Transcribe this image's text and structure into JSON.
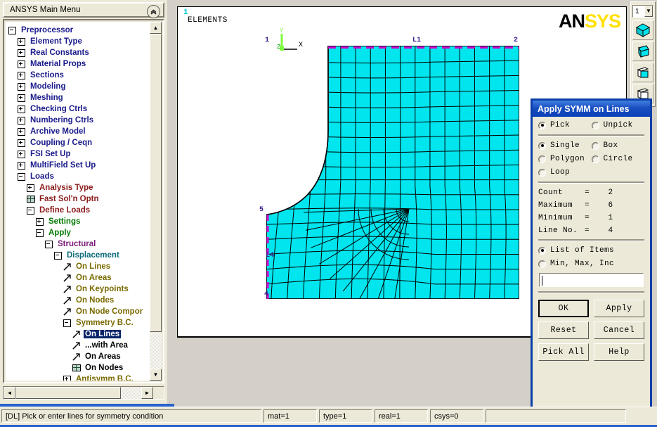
{
  "main_menu": {
    "title": "ANSYS Main Menu",
    "collapse_icon": "chevron-double-up-icon",
    "tree": [
      {
        "label": "Preprocessor",
        "indent": 0,
        "marker": "minus",
        "color": "c-navy"
      },
      {
        "label": "Element Type",
        "indent": 1,
        "marker": "plus",
        "color": "c-navy"
      },
      {
        "label": "Real Constants",
        "indent": 1,
        "marker": "plus",
        "color": "c-navy"
      },
      {
        "label": "Material Props",
        "indent": 1,
        "marker": "plus",
        "color": "c-navy"
      },
      {
        "label": "Sections",
        "indent": 1,
        "marker": "plus",
        "color": "c-navy"
      },
      {
        "label": "Modeling",
        "indent": 1,
        "marker": "plus",
        "color": "c-navy"
      },
      {
        "label": "Meshing",
        "indent": 1,
        "marker": "plus",
        "color": "c-navy"
      },
      {
        "label": "Checking Ctrls",
        "indent": 1,
        "marker": "plus",
        "color": "c-navy"
      },
      {
        "label": "Numbering Ctrls",
        "indent": 1,
        "marker": "plus",
        "color": "c-navy"
      },
      {
        "label": "Archive Model",
        "indent": 1,
        "marker": "plus",
        "color": "c-navy"
      },
      {
        "label": "Coupling / Ceqn",
        "indent": 1,
        "marker": "plus",
        "color": "c-navy"
      },
      {
        "label": "FSI Set Up",
        "indent": 1,
        "marker": "plus",
        "color": "c-navy"
      },
      {
        "label": "MultiField Set Up",
        "indent": 1,
        "marker": "plus",
        "color": "c-navy"
      },
      {
        "label": "Loads",
        "indent": 1,
        "marker": "minus",
        "color": "c-navy"
      },
      {
        "label": "Analysis Type",
        "indent": 2,
        "marker": "plus",
        "color": "c-dred"
      },
      {
        "label": "Fast Sol'n Optn",
        "indent": 2,
        "marker": "grid",
        "color": "c-dred"
      },
      {
        "label": "Define Loads",
        "indent": 2,
        "marker": "minus",
        "color": "c-dred"
      },
      {
        "label": "Settings",
        "indent": 3,
        "marker": "plus",
        "color": "c-green"
      },
      {
        "label": "Apply",
        "indent": 3,
        "marker": "minus",
        "color": "c-green"
      },
      {
        "label": "Structural",
        "indent": 4,
        "marker": "minus",
        "color": "c-purple"
      },
      {
        "label": "Displacement",
        "indent": 5,
        "marker": "minus",
        "color": "c-teal"
      },
      {
        "label": "On Lines",
        "indent": 6,
        "marker": "arrow",
        "color": "c-olive"
      },
      {
        "label": "On Areas",
        "indent": 6,
        "marker": "arrow",
        "color": "c-olive"
      },
      {
        "label": "On Keypoints",
        "indent": 6,
        "marker": "arrow",
        "color": "c-olive"
      },
      {
        "label": "On Nodes",
        "indent": 6,
        "marker": "arrow",
        "color": "c-olive"
      },
      {
        "label": "On Node Compor",
        "indent": 6,
        "marker": "arrow",
        "color": "c-olive"
      },
      {
        "label": "Symmetry B.C.",
        "indent": 6,
        "marker": "minus",
        "color": "c-olive"
      },
      {
        "label": "On Lines",
        "indent": 7,
        "marker": "arrow",
        "color": "c-black",
        "selected": true
      },
      {
        "label": "...with Area",
        "indent": 7,
        "marker": "arrow",
        "color": "c-black"
      },
      {
        "label": "On Areas",
        "indent": 7,
        "marker": "arrow",
        "color": "c-black"
      },
      {
        "label": "On Nodes",
        "indent": 7,
        "marker": "grid",
        "color": "c-black"
      },
      {
        "label": "Antisymm B.C.",
        "indent": 6,
        "marker": "plus",
        "color": "c-olive"
      }
    ],
    "scroll_up_glyph": "▲",
    "scroll_down_glyph": "▼",
    "scroll_left_glyph": "◄",
    "scroll_right_glyph": "►"
  },
  "graphics": {
    "window_number": "1",
    "plot_title": "ELEMENTS",
    "logo_an": "AN",
    "logo_sys": "SYS",
    "triad": {
      "x_label": "X",
      "y_label": "Y",
      "z_label": "Z"
    },
    "mesh_labels": {
      "kp_top_left": "1",
      "line_top": "L1",
      "kp_top_right": "2",
      "kp_left_upper": "5",
      "line_left": "L4",
      "kp_left_lower": "4"
    },
    "mesh_color": "#00e5ee",
    "symmetry_line_color": "#cc00cc"
  },
  "toolbar": {
    "view_number": "1",
    "dropdown_glyph": "▼",
    "buttons": [
      {
        "name": "isometric-view-icon"
      },
      {
        "name": "oblique-view-icon"
      },
      {
        "name": "front-view-icon"
      },
      {
        "name": "rotate-view-icon"
      }
    ]
  },
  "pick_dialog": {
    "title": "Apply SYMM on Lines",
    "mode": [
      {
        "label": "Pick",
        "selected": true
      },
      {
        "label": "Unpick",
        "selected": false
      }
    ],
    "method": [
      {
        "label": "Single",
        "selected": true
      },
      {
        "label": "Box",
        "selected": false
      },
      {
        "label": "Polygon",
        "selected": false
      },
      {
        "label": "Circle",
        "selected": false
      },
      {
        "label": "Loop",
        "selected": false
      }
    ],
    "stats": [
      {
        "key": "Count",
        "eq": "=",
        "value": "2"
      },
      {
        "key": "Maximum",
        "eq": "=",
        "value": "6"
      },
      {
        "key": "Minimum",
        "eq": "=",
        "value": "1"
      },
      {
        "key": "Line No.",
        "eq": "=",
        "value": "4"
      }
    ],
    "entry_mode": [
      {
        "label": "List of Items",
        "selected": true
      },
      {
        "label": "Min, Max, Inc",
        "selected": false
      }
    ],
    "input_value": "",
    "buttons": {
      "ok": "OK",
      "apply": "Apply",
      "reset": "Reset",
      "cancel": "Cancel",
      "pick_all": "Pick All",
      "help": "Help"
    }
  },
  "status_bar": {
    "message": "[DL] Pick or enter lines for symmetry condition",
    "mat": "mat=1",
    "type": "type=1",
    "real": "real=1",
    "csys": "csys=0",
    "extra": ""
  }
}
